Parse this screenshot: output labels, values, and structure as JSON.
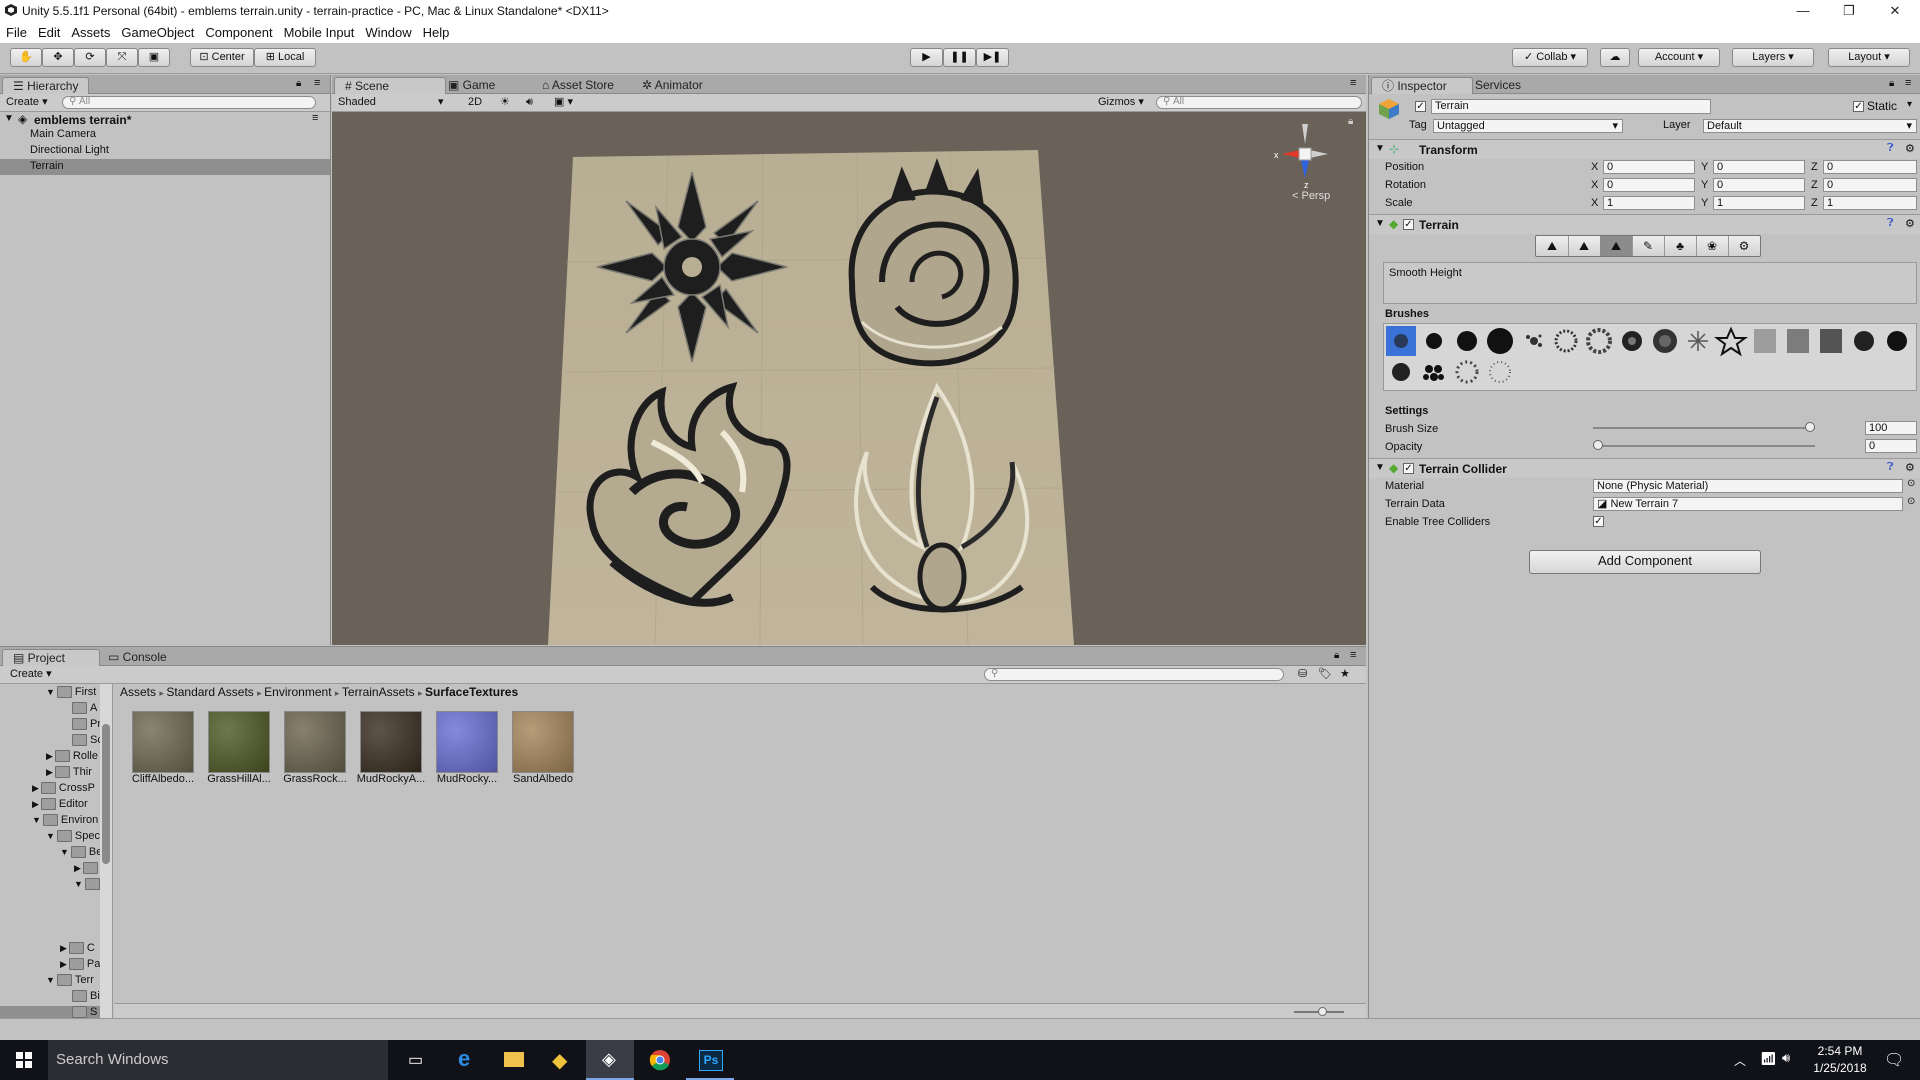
{
  "window": {
    "title": "Unity 5.5.1f1 Personal (64bit) - emblems terrain.unity - terrain-practice - PC, Mac & Linux Standalone* <DX11>",
    "controls": [
      "—",
      "❐",
      "✕"
    ]
  },
  "menu": [
    "File",
    "Edit",
    "Assets",
    "GameObject",
    "Component",
    "Mobile Input",
    "Window",
    "Help"
  ],
  "toolbar": {
    "pivot": "Center",
    "space": "Local",
    "collab": "Collab ▾",
    "account": "Account",
    "layers": "Layers",
    "layout": "Layout"
  },
  "hierarchy": {
    "tab": "Hierarchy",
    "create": "Create",
    "search_placeholder": "All",
    "scene": "emblems terrain*",
    "items": [
      "Main Camera",
      "Directional Light",
      "Terrain"
    ],
    "selected": "Terrain"
  },
  "scene_view": {
    "tabs": [
      "Scene",
      "Game",
      "Asset Store",
      "Animator"
    ],
    "shading": "Shaded",
    "mode_2d": "2D",
    "gizmos": "Gizmos",
    "search_placeholder": "All",
    "persp": "< Persp",
    "axes": {
      "x": "x",
      "y": "y",
      "z": "z"
    }
  },
  "inspector": {
    "tabs": [
      "Inspector",
      "Services"
    ],
    "object_name": "Terrain",
    "static_label": "Static",
    "tag_label": "Tag",
    "tag_value": "Untagged",
    "layer_label": "Layer",
    "layer_value": "Default",
    "transform": {
      "title": "Transform",
      "rows": [
        {
          "label": "Position",
          "x": "0",
          "y": "0",
          "z": "0"
        },
        {
          "label": "Rotation",
          "x": "0",
          "y": "0",
          "z": "0"
        },
        {
          "label": "Scale",
          "x": "1",
          "y": "1",
          "z": "1"
        }
      ]
    },
    "terrain": {
      "title": "Terrain",
      "tool_description": "Smooth Height",
      "brushes_label": "Brushes",
      "settings_label": "Settings",
      "brush_size_label": "Brush Size",
      "brush_size_value": "100",
      "brush_size_fraction": 1.0,
      "opacity_label": "Opacity",
      "opacity_value": "0",
      "opacity_fraction": 0.0
    },
    "terrain_collider": {
      "title": "Terrain Collider",
      "material_label": "Material",
      "material_value": "None (Physic Material)",
      "terrain_data_label": "Terrain Data",
      "terrain_data_value": "New Terrain 7",
      "enable_tree_label": "Enable Tree Colliders"
    },
    "add_component": "Add Component"
  },
  "project": {
    "tabs": [
      "Project",
      "Console"
    ],
    "create": "Create",
    "breadcrumb": [
      "Assets",
      "Standard Assets",
      "Environment",
      "TerrainAssets",
      "SurfaceTextures"
    ],
    "tree": [
      "First",
      "A",
      "Pr",
      "Sc",
      "Rolle",
      "Thir",
      "CrossP",
      "Editor",
      "Environ",
      "Spec",
      "Be",
      "C",
      "Pa",
      "Terr",
      "Bi",
      "S"
    ],
    "assets": [
      {
        "name": "CliffAlbedo...",
        "color": "#6e6b52"
      },
      {
        "name": "GrassHillAl...",
        "color": "#4f5a26"
      },
      {
        "name": "GrassRock...",
        "color": "#6d6550"
      },
      {
        "name": "MudRockyA...",
        "color": "#3a2e22"
      },
      {
        "name": "MudRocky...",
        "color": "#6a70d6"
      },
      {
        "name": "SandAlbedo",
        "color": "#a6875c"
      }
    ]
  },
  "taskbar": {
    "search": "Search Windows",
    "time": "2:54 PM",
    "date": "1/25/2018"
  },
  "colors": {
    "scene_bg": "#6a6258",
    "terrain": "#b9ae94",
    "selection": "#3a72d8"
  }
}
